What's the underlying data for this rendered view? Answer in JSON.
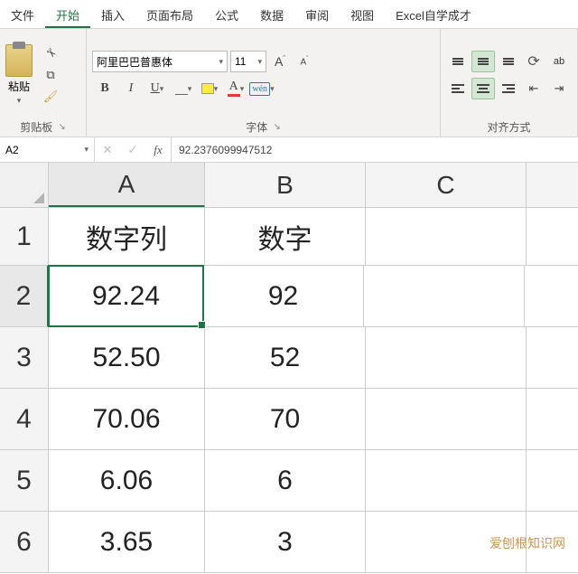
{
  "tabs": [
    "文件",
    "开始",
    "插入",
    "页面布局",
    "公式",
    "数据",
    "审阅",
    "视图",
    "Excel自学成才"
  ],
  "active_tab": 1,
  "ribbon": {
    "clipboard": {
      "paste": "粘贴",
      "group": "剪贴板"
    },
    "font": {
      "name": "阿里巴巴普惠体",
      "size": "11",
      "increase": "A",
      "decrease": "A",
      "bold": "B",
      "italic": "I",
      "underline": "U",
      "wen": "wén",
      "group": "字体"
    },
    "align": {
      "ab": "ab",
      "group": "对齐方式"
    }
  },
  "formula_bar": {
    "name": "A2",
    "value": "92.2376099947512"
  },
  "columns": [
    "A",
    "B",
    "C"
  ],
  "rows": [
    {
      "n": "1",
      "A": "数字列",
      "B": "数字",
      "C": ""
    },
    {
      "n": "2",
      "A": "92.24",
      "B": "92",
      "C": ""
    },
    {
      "n": "3",
      "A": "52.50",
      "B": "52",
      "C": ""
    },
    {
      "n": "4",
      "A": "70.06",
      "B": "70",
      "C": ""
    },
    {
      "n": "5",
      "A": "6.06",
      "B": "6",
      "C": ""
    },
    {
      "n": "6",
      "A": "3.65",
      "B": "3",
      "C": ""
    }
  ],
  "active_cell": {
    "row": 1,
    "col": "A"
  },
  "watermark": "爱刨根知识网"
}
